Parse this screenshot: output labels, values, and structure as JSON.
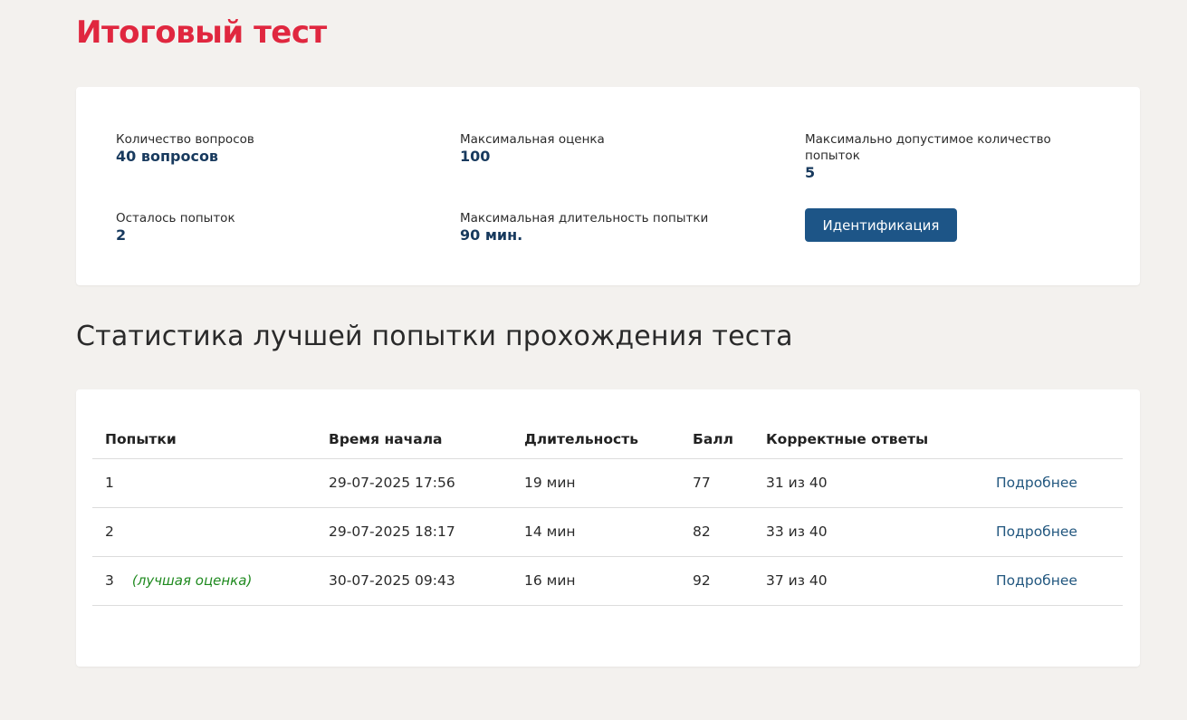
{
  "page": {
    "title": "Итоговый тест"
  },
  "info": {
    "questions_count": {
      "label": "Количество вопросов",
      "value": "40 вопросов"
    },
    "max_score": {
      "label": "Максимальная оценка",
      "value": "100"
    },
    "max_attempts": {
      "label": "Максимально допустимое количество попыток",
      "value": "5"
    },
    "attempts_left": {
      "label": "Осталось попыток",
      "value": "2"
    },
    "max_duration": {
      "label": "Максимальная длительность попытки",
      "value": "90 мин."
    },
    "ident_button_label": "Идентификация"
  },
  "stats": {
    "title": "Статистика лучшей попытки прохождения теста",
    "headers": [
      "Попытки",
      "Время начала",
      "Длительность",
      "Балл",
      "Корректные ответы",
      ""
    ],
    "rows": [
      {
        "attempt": "1",
        "note": "",
        "start": "29-07-2025 17:56",
        "duration": "19 мин",
        "score": "77",
        "correct": "31 из 40",
        "link": "Подробнее"
      },
      {
        "attempt": "2",
        "note": "",
        "start": "29-07-2025 18:17",
        "duration": "14 мин",
        "score": "82",
        "correct": "33 из 40",
        "link": "Подробнее"
      },
      {
        "attempt": "3",
        "note": "(лучшая оценка)",
        "start": "30-07-2025 09:43",
        "duration": "16 мин",
        "score": "92",
        "correct": "37 из 40",
        "link": "Подробнее"
      }
    ]
  },
  "colors": {
    "title_red": "#e0273f",
    "value_navy": "#183a5e",
    "button_blue": "#1d5587",
    "best_green": "#1f8a1f",
    "link_blue": "#22577f",
    "background": "#f3f1ee"
  }
}
